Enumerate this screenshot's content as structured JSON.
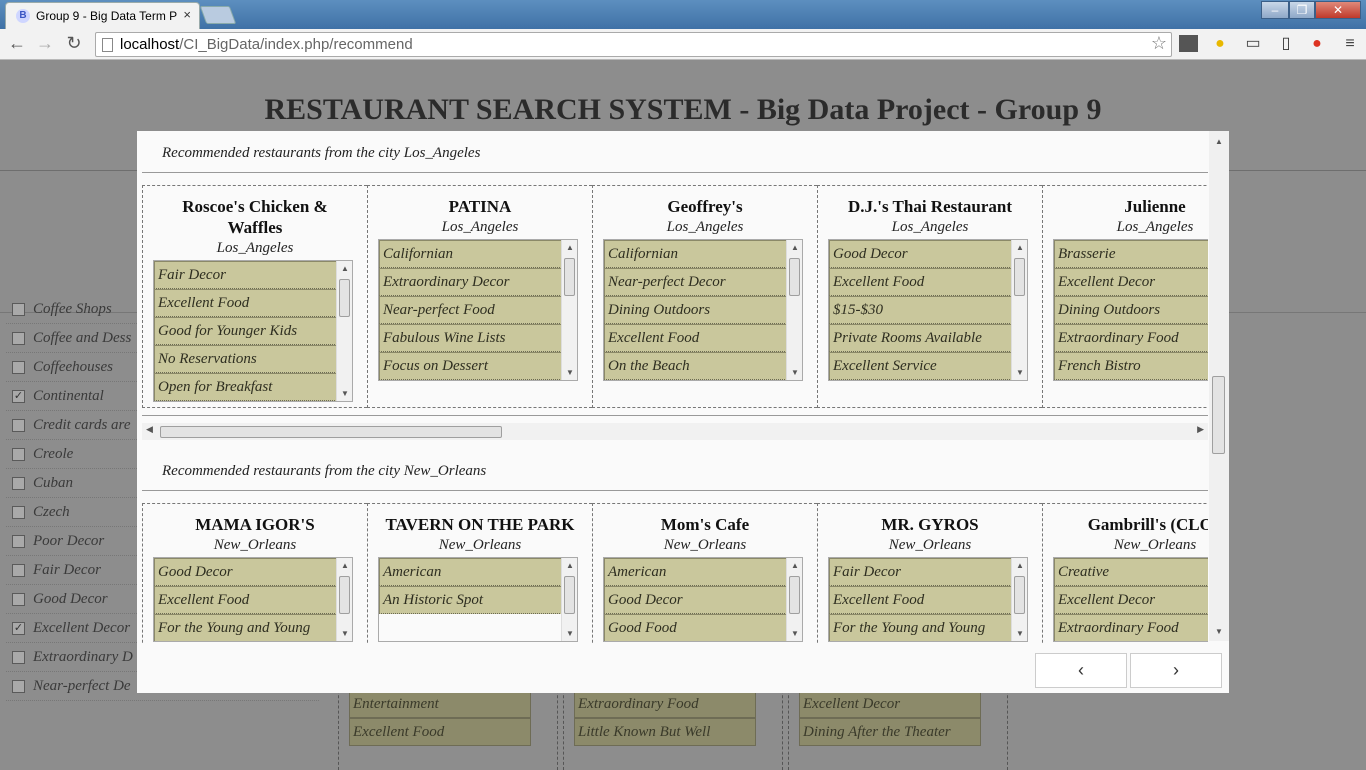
{
  "browser": {
    "tab_title": "Group 9 - Big Data Term P",
    "tab_favicon": "B",
    "close_glyph": "×",
    "url_host": "localhost",
    "url_path": "/CI_BigData/index.php/recommend"
  },
  "page": {
    "heading": "RESTAURANT SEARCH SYSTEM - Big Data Project - Group 9"
  },
  "filters": [
    {
      "label": "Coffee Shops",
      "checked": false
    },
    {
      "label": "Coffee and Dess",
      "checked": false
    },
    {
      "label": "Coffeehouses",
      "checked": false
    },
    {
      "label": "Continental",
      "checked": true
    },
    {
      "label": "Credit cards are",
      "checked": false
    },
    {
      "label": "Creole",
      "checked": false
    },
    {
      "label": "Cuban",
      "checked": false
    },
    {
      "label": "Czech",
      "checked": false
    },
    {
      "label": "Poor Decor",
      "checked": false
    },
    {
      "label": "Fair Decor",
      "checked": false
    },
    {
      "label": "Good Decor",
      "checked": false
    },
    {
      "label": "Excellent Decor",
      "checked": true
    },
    {
      "label": "Extraordinary D",
      "checked": false
    },
    {
      "label": "Near-perfect De",
      "checked": false
    }
  ],
  "background_cards": [
    [
      "Entertainment",
      "Excellent Food"
    ],
    [
      "Extraordinary Food",
      "Little Known But Well"
    ],
    [
      "Excellent Decor",
      "Dining After the Theater"
    ]
  ],
  "modal": {
    "sections": [
      {
        "title": "Recommended restaurants from the city Los_Angeles",
        "restaurants": [
          {
            "name": "Roscoe's Chicken & Waffles",
            "city": "Los_Angeles",
            "tags": [
              "Fair Decor",
              "Excellent Food",
              "Good for Younger Kids",
              "No Reservations",
              "Open for Breakfast"
            ]
          },
          {
            "name": "PATINA",
            "city": "Los_Angeles",
            "tags": [
              "Californian",
              "Extraordinary Decor",
              "Near-perfect Food",
              "Fabulous Wine Lists",
              "Focus on Dessert"
            ]
          },
          {
            "name": "Geoffrey's",
            "city": "Los_Angeles",
            "tags": [
              "Californian",
              "Near-perfect Decor",
              "Dining Outdoors",
              "Excellent Food",
              "On the Beach"
            ]
          },
          {
            "name": "D.J.'s Thai Restaurant",
            "city": "Los_Angeles",
            "tags": [
              "Good Decor",
              "Excellent Food",
              "$15-$30",
              "Private Rooms Available",
              "Excellent Service"
            ]
          },
          {
            "name": "Julienne",
            "city": "Los_Angeles",
            "tags": [
              "Brasserie",
              "Excellent Decor",
              "Dining Outdoors",
              "Extraordinary Food",
              "French Bistro"
            ]
          }
        ]
      },
      {
        "title": "Recommended restaurants from the city New_Orleans",
        "restaurants": [
          {
            "name": "MAMA IGOR'S",
            "city": "New_Orleans",
            "tags": [
              "Good Decor",
              "Excellent Food",
              "For the Young and Young"
            ]
          },
          {
            "name": "TAVERN ON THE PARK",
            "city": "New_Orleans",
            "tags": [
              "American",
              "An Historic Spot"
            ]
          },
          {
            "name": "Mom's Cafe",
            "city": "New_Orleans",
            "tags": [
              "American",
              "Good Decor",
              "Good Food"
            ]
          },
          {
            "name": "MR. GYROS",
            "city": "New_Orleans",
            "tags": [
              "Fair Decor",
              "Excellent Food",
              "For the Young and Young"
            ]
          },
          {
            "name": "Gambrill's (CLOS",
            "city": "New_Orleans",
            "tags": [
              "Creative",
              "Excellent Decor",
              "Extraordinary Food"
            ]
          }
        ]
      }
    ],
    "prev_label": "‹",
    "next_label": "›"
  }
}
